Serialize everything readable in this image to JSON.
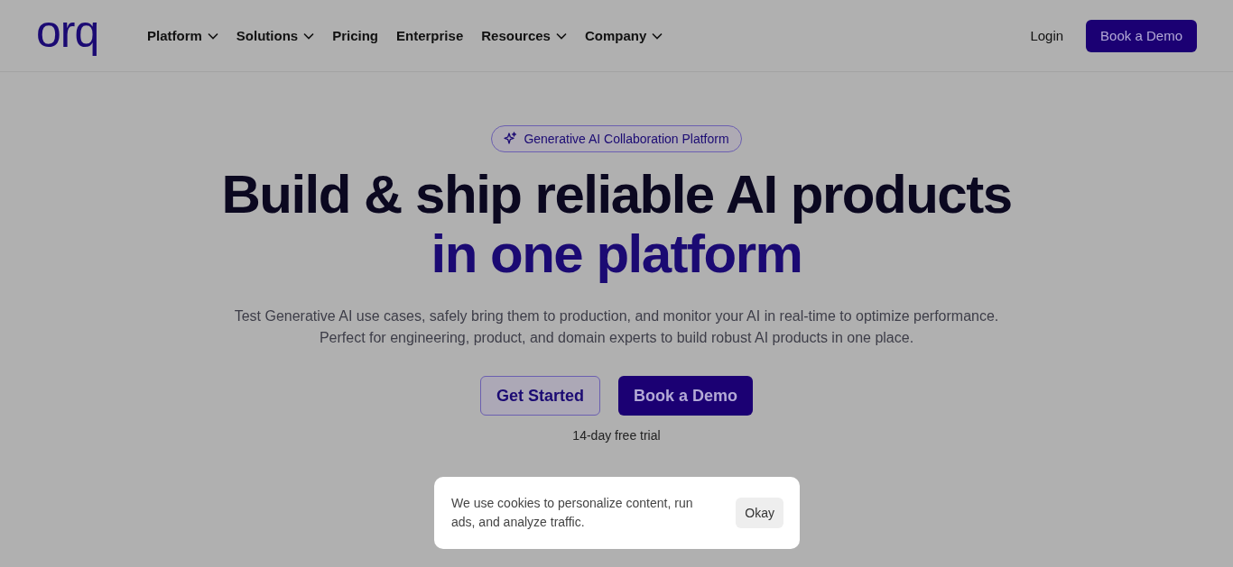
{
  "header": {
    "logo": "orq",
    "nav": [
      {
        "label": "Platform",
        "has_menu": true
      },
      {
        "label": "Solutions",
        "has_menu": true
      },
      {
        "label": "Pricing",
        "has_menu": false
      },
      {
        "label": "Enterprise",
        "has_menu": false
      },
      {
        "label": "Resources",
        "has_menu": true
      },
      {
        "label": "Company",
        "has_menu": true
      }
    ],
    "login": "Login",
    "cta": "Book a Demo"
  },
  "hero": {
    "badge": "Generative AI Collaboration Platform",
    "title_line_1": "Build & ship reliable AI products",
    "title_line_2": "in one platform",
    "subtitle_lines": [
      "Test Generative AI use cases, safely bring them to production, and monitor your AI in real-time to optimize performance.",
      "Perfect for engineering, product, and domain experts to build robust AI products in one place."
    ],
    "buttons": [
      {
        "label": "Get Started",
        "kind": "outline"
      },
      {
        "label": "Book a Demo",
        "kind": "solid"
      }
    ],
    "note": "14-day free trial"
  },
  "cookie_banner": {
    "message": "We use cookies to personalize content, run ads, and analyze traffic.",
    "button": "Okay"
  }
}
